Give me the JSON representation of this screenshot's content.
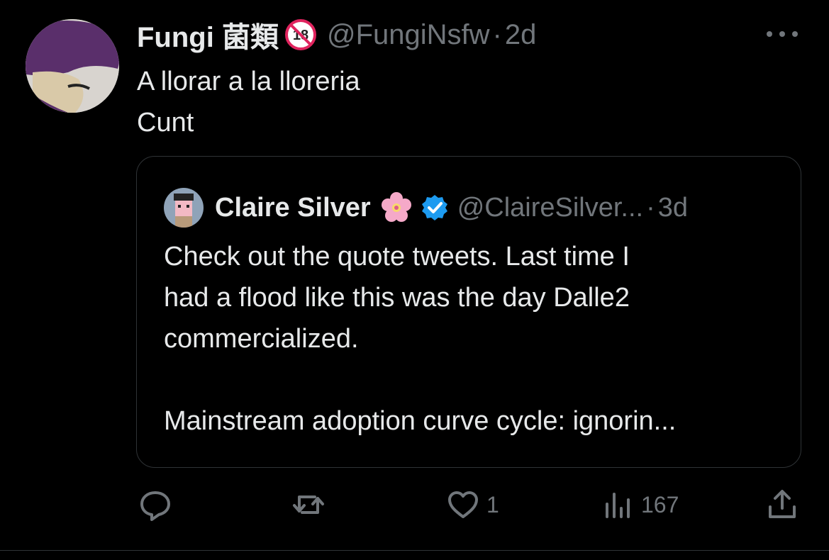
{
  "tweet": {
    "author_name": "Fungi 菌類",
    "handle": "@FungiNsfw",
    "dot": "·",
    "time": "2d",
    "lines": [
      "A llorar a la lloreria",
      "Cunt"
    ]
  },
  "quote": {
    "author_name": "Claire Silver",
    "handle": "@ClaireSilver...",
    "dot": "·",
    "time": "3d",
    "text": "Check out the quote tweets. Last time I\nhad a flood like this was the day Dalle2\ncommercialized.\n\nMainstream adoption curve cycle: ignorin..."
  },
  "actions": {
    "reply_count": "",
    "retweet_count": "",
    "like_count": "1",
    "views_count": "167"
  },
  "icons": {
    "age_badge": "18-plus-icon",
    "more": "more-options-icon",
    "emoji": "cherry-blossom-icon",
    "verified": "verified-badge-icon",
    "reply": "reply-icon",
    "retweet": "retweet-icon",
    "like": "heart-icon",
    "views": "views-icon",
    "share": "share-icon"
  },
  "colors": {
    "background": "#000000",
    "primary_text": "#e7e9ea",
    "secondary_text": "#71767b",
    "verified_blue": "#1d9bf0",
    "badge_red": "#e0245e"
  }
}
